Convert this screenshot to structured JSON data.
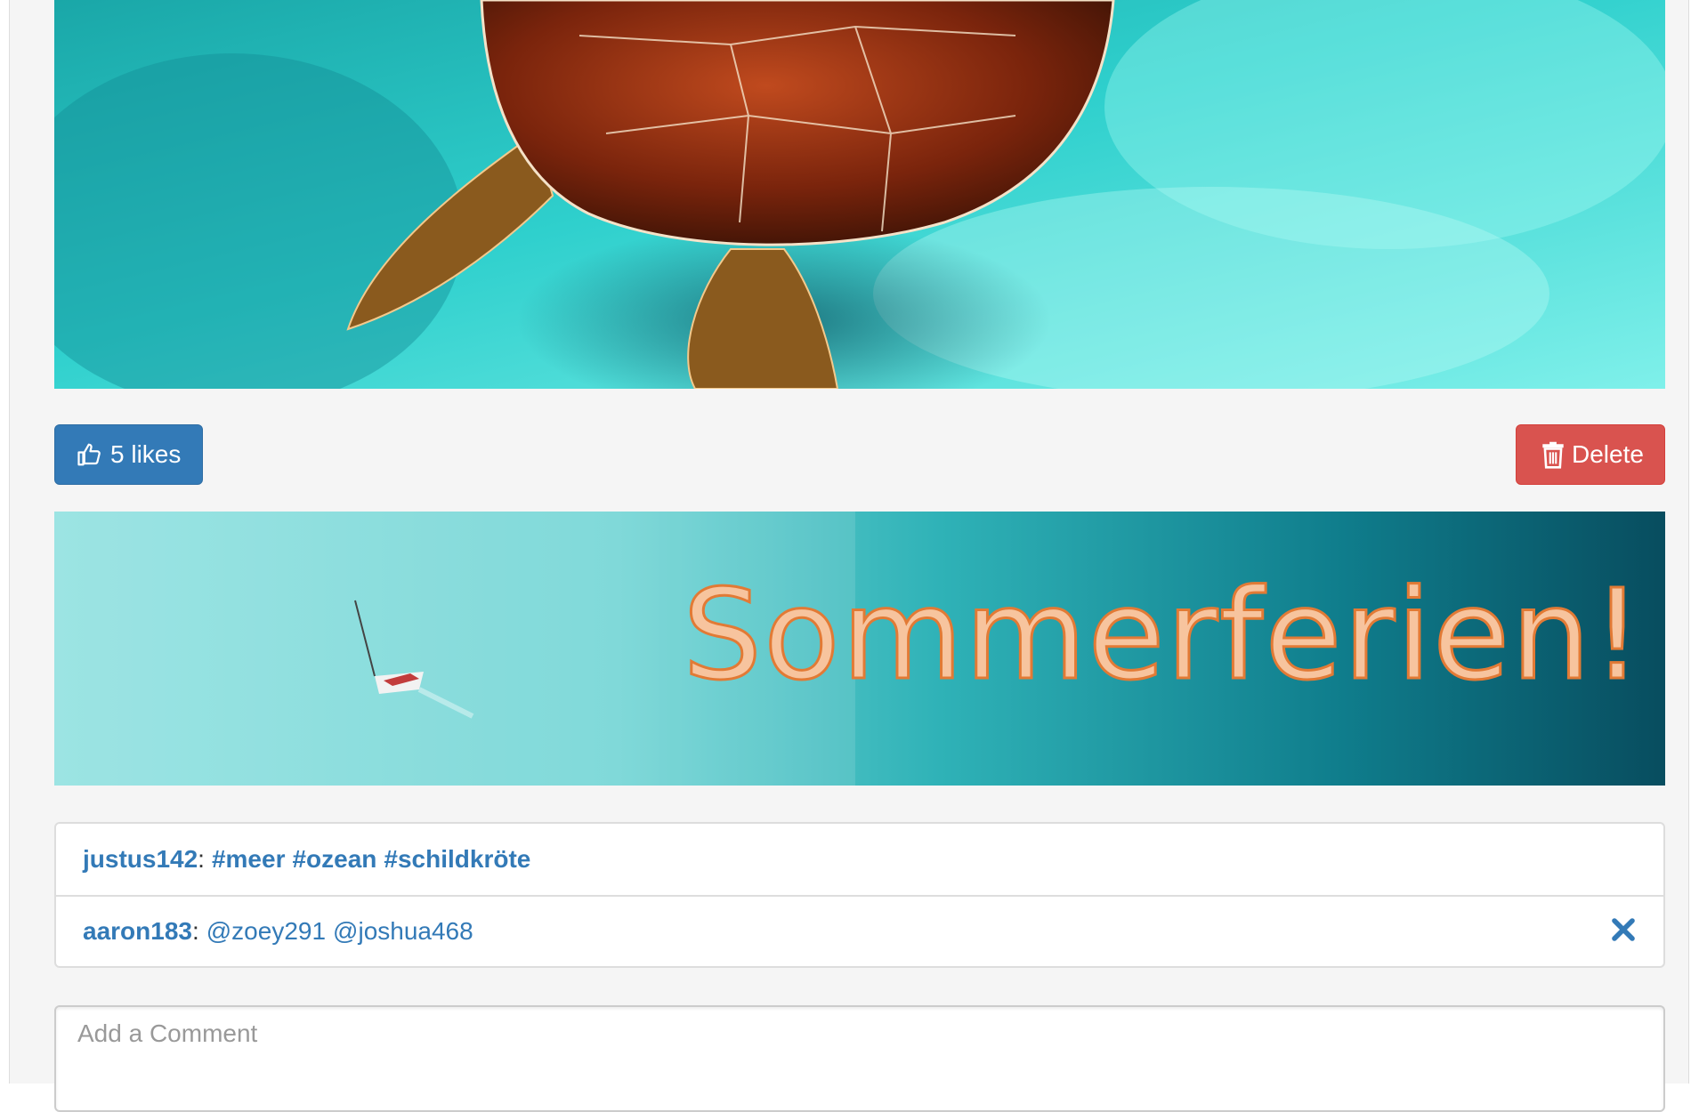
{
  "post": {
    "likes_label": "5 likes",
    "delete_label": "Delete"
  },
  "banner": {
    "text": "Sommerferien!"
  },
  "comments": [
    {
      "user": "justus142",
      "separator": ":",
      "hashtags": [
        "#meer",
        "#ozean",
        "#schildkröte"
      ]
    },
    {
      "user": "aaron183",
      "separator": ":",
      "mentions": [
        "@zoey291",
        "@joshua468"
      ]
    }
  ],
  "comment_input": {
    "placeholder": "Add a Comment"
  },
  "icons": {
    "like": "thumbs-up-icon",
    "delete": "trash-icon",
    "remove_comment": "close-icon"
  },
  "colors": {
    "primary": "#337ab7",
    "danger": "#d9534f",
    "banner_text": "#f7c49e"
  }
}
